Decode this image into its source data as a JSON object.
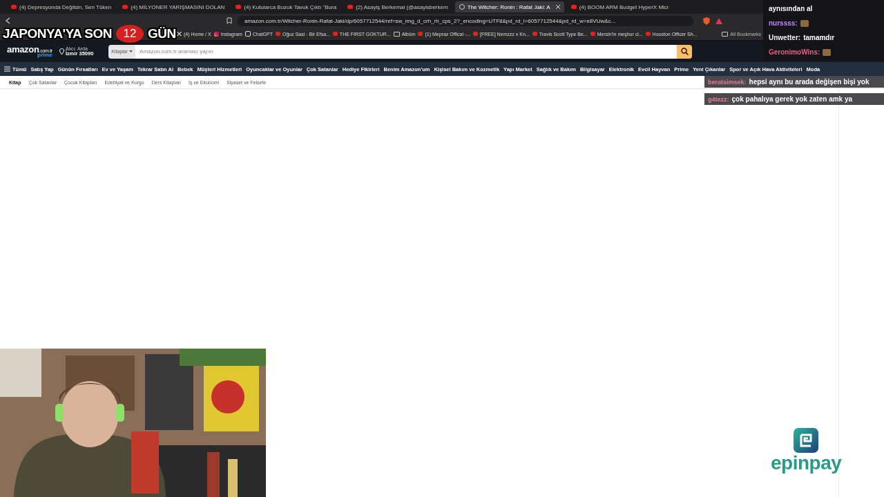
{
  "browser": {
    "tabs": [
      {
        "title": "(4) Depresyonda Değilsin, Sen Tüken",
        "selected": false
      },
      {
        "title": "(4) MİLYONER YARIŞMASINI DOLAN",
        "selected": false
      },
      {
        "title": "(4) Kutularca Bozuk Tavuk Çıktı \"Bura",
        "selected": false
      },
      {
        "title": "(2) Asayiş Berkemal (@asayisberkem",
        "selected": false
      },
      {
        "title": "The Witcher: Ronin : Rafat Jaki: A",
        "selected": true
      },
      {
        "title": "(4) BOOM ARM Budget HyperX Micr",
        "selected": false
      }
    ],
    "url": "amazon.com.tr/Witcher-Ronin-Rafat-Jaki/dp/6057712544/ref=sw_img_d_crh_rh_cps_2?_encoding=UTF8&pd_rd_i=6057712544&pd_rd_w=e8VUw&c...",
    "bookmarks": [
      {
        "label": "(4) Home / X",
        "kind": "x"
      },
      {
        "label": "Instagram",
        "kind": "instagram"
      },
      {
        "label": "ChatGPT",
        "kind": "chatgpt"
      },
      {
        "label": "Oğuz Sasi - Bir Efsa...",
        "kind": "video"
      },
      {
        "label": "THE FIRST GOKTUR...",
        "kind": "video"
      },
      {
        "label": "Albüm",
        "kind": "folder"
      },
      {
        "label": "(1) Mepraz Offical -...",
        "kind": "video"
      },
      {
        "label": "[FREE] Nemzzz x Kn...",
        "kind": "video"
      },
      {
        "label": "Travis Scott Type Be...",
        "kind": "video"
      },
      {
        "label": "Mersin'in meşhur ci...",
        "kind": "video"
      },
      {
        "label": "Houston Officer Sh...",
        "kind": "video"
      }
    ],
    "all_bookmarks": "All Bookmarks"
  },
  "amazon": {
    "logo": "amazon",
    "logo_domain": ".com.tr",
    "logo_prime": "prime",
    "deliver_label": "Alıcı: Arda",
    "deliver_location": "İzmir 35090",
    "search": {
      "category": "Kitaplar",
      "placeholder": "Amazon.com.tr araması yapın"
    },
    "menu_label": "Tümü",
    "nav": [
      "Satış Yap",
      "Günün Fırsatları",
      "Ev ve Yaşam",
      "Tekrar Satın Al",
      "Bebek",
      "Müşteri Hizmetleri",
      "Oyuncaklar ve Oyunlar",
      "Çok Satanlar",
      "Hediye Fikirleri",
      "Benim Amazon'um",
      "Kişisel Bakım ve Kozmetik",
      "Yapı Market",
      "Sağlık ve Bakım",
      "Bilgisayar",
      "Elektronik",
      "Evcil Hayvan",
      "Prime",
      "Yeni Çıkanlar",
      "Spor ve Açık Hava Aktiviteleri",
      "Moda"
    ],
    "subnav": [
      {
        "label": "Kitap",
        "selected": true
      },
      {
        "label": "Çok Satanlar",
        "selected": false
      },
      {
        "label": "Çocuk Kitapları",
        "selected": false
      },
      {
        "label": "Edebiyat ve Kurgu",
        "selected": false
      },
      {
        "label": "Ders Kitapları",
        "selected": false
      },
      {
        "label": "İş ve Ekonomi",
        "selected": false
      },
      {
        "label": "Siyaset ve Felsefe",
        "selected": false
      }
    ]
  },
  "stream_title": {
    "prefix": "JAPONYA'YA SON",
    "days": "12",
    "suffix": "GÜN"
  },
  "chat": {
    "panel": [
      {
        "text": "aynısından al",
        "emote": false
      },
      {
        "user": "nurssss:",
        "color": "#b98cf2",
        "emote": true
      },
      {
        "user": "Unwetter:",
        "text": "tamamdır",
        "color": "#f2f2f2",
        "emote": false
      },
      {
        "user": "GeronimoWins:",
        "color": "#e8607e",
        "emote": true
      }
    ],
    "bubbles": [
      {
        "user": "beratsimsek:",
        "text": "hepsi aynı bu arada değişen bişi yok",
        "color": "#e87d96"
      },
      {
        "user": "g4tezz:",
        "text": "çok pahalıya gerek yok zaten amk ya",
        "color": "#e87d96"
      }
    ]
  },
  "sponsor": {
    "name": "epinpay"
  }
}
